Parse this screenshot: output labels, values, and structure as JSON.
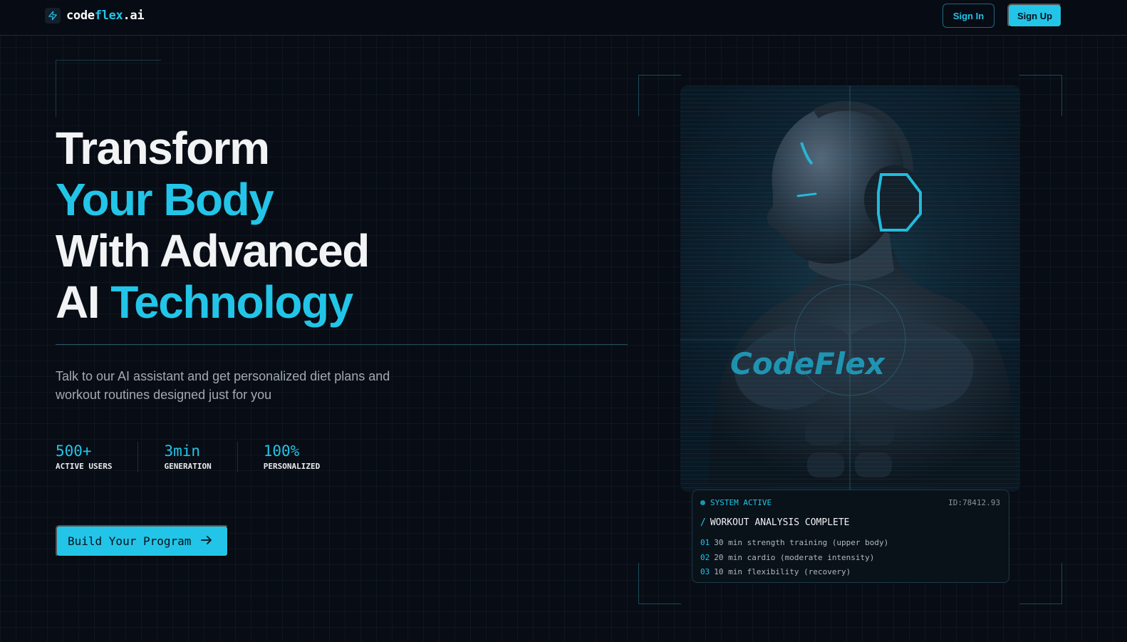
{
  "nav": {
    "logo_prefix": "code",
    "logo_accent": "flex",
    "logo_suffix": ".ai",
    "sign_in": "Sign In",
    "sign_up": "Sign Up"
  },
  "hero": {
    "line1": "Transform",
    "line2": "Your Body",
    "line3": "With Advanced",
    "line4_white": "AI",
    "line4_cyan": "Technology",
    "subtitle_line1": "Talk to our AI assistant and get personalized diet plans and",
    "subtitle_line2": "workout routines designed just for you",
    "stats": [
      {
        "value": "500+",
        "label": "ACTIVE USERS"
      },
      {
        "value": "3min",
        "label": "GENERATION"
      },
      {
        "value": "100%",
        "label": "PERSONALIZED"
      }
    ],
    "cta": "Build Your Program",
    "cta_icon": "arrow-right-icon"
  },
  "visual": {
    "image_text": "CodeFlex",
    "status": {
      "indicator": "SYSTEM ACTIVE",
      "id": "ID:78412.93",
      "slash": "/",
      "title": "WORKOUT ANALYSIS COMPLETE",
      "items": [
        {
          "num": "01",
          "text": "30 min strength training (upper body)"
        },
        {
          "num": "02",
          "text": "20 min cardio (moderate intensity)"
        },
        {
          "num": "03",
          "text": "10 min flexibility (recovery)"
        }
      ]
    }
  },
  "colors": {
    "background": "#080c14",
    "accent": "#22c5e8",
    "text": "#f2f3f5",
    "muted": "#a3a9b4"
  }
}
